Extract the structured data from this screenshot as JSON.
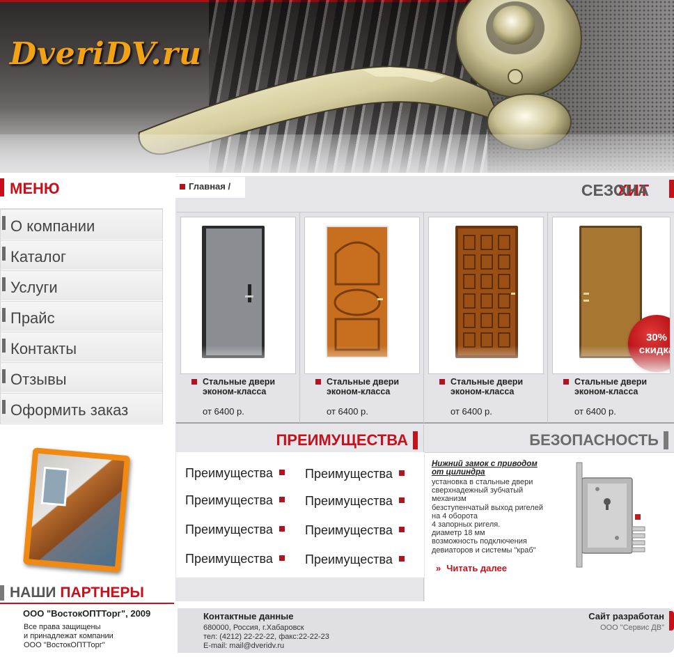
{
  "header": {
    "logo": "DveriDV.ru"
  },
  "menu": {
    "title": "МЕНЮ",
    "items": [
      {
        "label": "О компании"
      },
      {
        "label": "Каталог"
      },
      {
        "label": "Услуги"
      },
      {
        "label": "Прайс"
      },
      {
        "label": "Контакты"
      },
      {
        "label": "Отзывы"
      },
      {
        "label": "Оформить заказ"
      }
    ]
  },
  "partners": {
    "title_part1": "НАШИ",
    "title_part2": "ПАРТНЕРЫ"
  },
  "copyright": {
    "company": "ООО \"ВостокОПТТорг\", 2009",
    "text": "Все права защищены\nи принадлежат компании\nООО \"ВостокОПТТорг\""
  },
  "breadcrumb": {
    "label": "Главная /"
  },
  "hit": {
    "title_part1": "ХИТ",
    "title_part2": "СЕЗОНА"
  },
  "products": [
    {
      "name": "Стальные двери эконом-класса",
      "price": "от 6400 р.",
      "door_color": "#8a8d92"
    },
    {
      "name": "Стальные двери эконом-класса",
      "price": "от 6400 р.",
      "door_color": "#c76f1f"
    },
    {
      "name": "Стальные двери эконом-класса",
      "price": "от 6400 р.",
      "door_color": "#9a4f14"
    },
    {
      "name": "Стальные двери эконом-класса",
      "price": "от 6400 р.",
      "door_color": "#a67632"
    }
  ],
  "badge": {
    "line1": "30%",
    "line2": "скидка"
  },
  "advantages": {
    "title": "ПРЕИМУЩЕСТВА",
    "items": [
      "Преимущества",
      "Преимущества",
      "Преимущества",
      "Преимущества",
      "Преимущества",
      "Преимущества",
      "Преимущества",
      "Преимущества"
    ]
  },
  "security": {
    "title": "БЕЗОПАСНОСТЬ",
    "headline": "Нижний замок с приводом от цилиндра",
    "text": "установка в стальные двери\nсверхнадежный зубчатый\nмеханизм\nбезступенчатый выход ригелей\nна 4 оборота\n4 запорных ригеля.\nдиаметр 18 мм\nвозможность подключения\nдевиаторов и системы \"краб\"",
    "more": "Читать далее"
  },
  "footer": {
    "contacts_title": "Контактные данные",
    "contacts_text": "680000, Россия, г.Хабаровск\nтел: (4212) 22-22-22, факс:22-22-23\nE-mail: mail@dveridv.ru",
    "dev_title": "Сайт разработан",
    "dev_company": "ООО \"Сервис ДВ\""
  },
  "colors": {
    "accent_red": "#c8101b",
    "logo_gold": "#f2a315"
  },
  "icons": {
    "bullet": "red-square-icon",
    "more": "double-chevron-icon"
  }
}
